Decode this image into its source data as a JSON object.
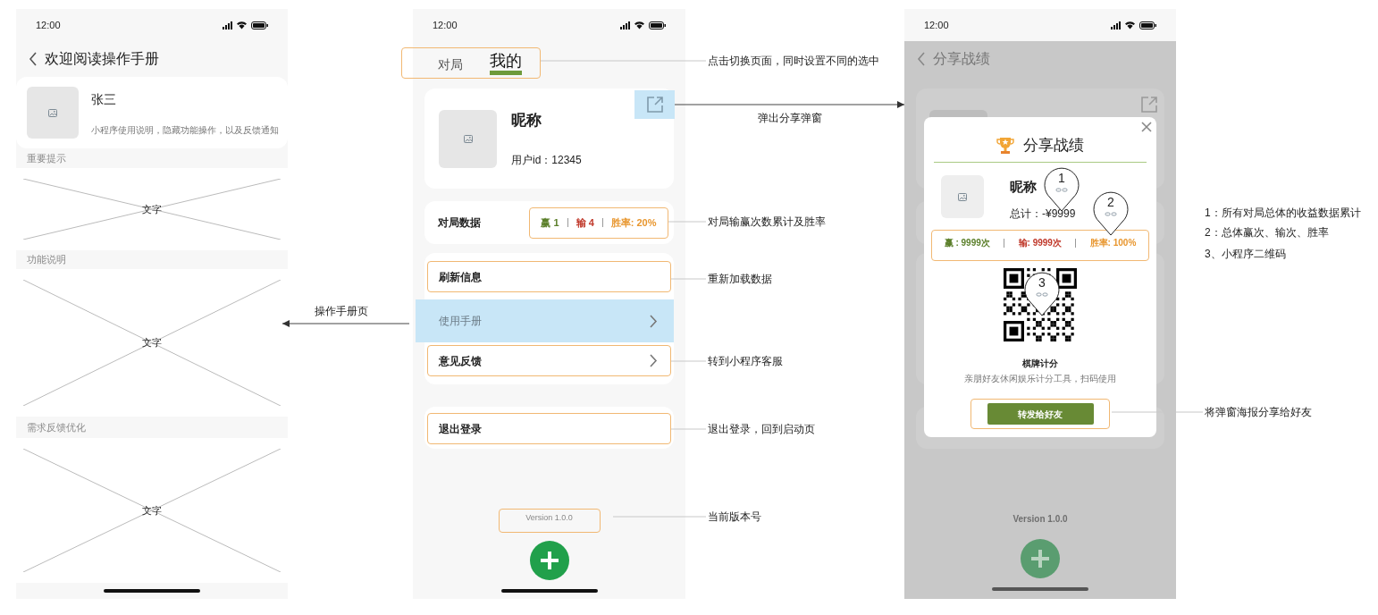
{
  "screens": [
    {
      "kind": "manual",
      "status_time": "12:00",
      "title": "欢迎阅读操作手册",
      "profile": {
        "name": "张三",
        "description": "小程序使用说明，隐藏功能操作，以及反馈通知"
      },
      "sections": [
        {
          "heading": "重要提示",
          "placeholder_text": "文字"
        },
        {
          "heading": "功能说明",
          "placeholder_text": "文字"
        },
        {
          "heading": "需求反馈优化",
          "placeholder_text": "文字"
        }
      ]
    },
    {
      "kind": "profile",
      "status_time": "12:00",
      "tabs": [
        {
          "label": "对局",
          "selected": false
        },
        {
          "label": "我的",
          "selected": true
        }
      ],
      "profile": {
        "nickname": "昵称",
        "user_id": "用户id：12345"
      },
      "stats": {
        "label": "对局数据",
        "wins": "赢 1",
        "losses": "输 4",
        "win_rate": "胜率: 20%"
      },
      "menu": [
        {
          "label": "刷新信息",
          "chevron": false,
          "highlighted": false
        },
        {
          "label": "使用手册",
          "chevron": true,
          "highlighted": true
        },
        {
          "label": "意见反馈",
          "chevron": true,
          "highlighted": false
        }
      ],
      "logout": "退出登录",
      "version": "Version 1.0.0"
    },
    {
      "kind": "share",
      "status_time": "12:00",
      "title": "分享战绩",
      "version": "Version 1.0.0",
      "modal": {
        "title": "分享战绩",
        "nickname": "昵称",
        "total": "总计：-¥9999",
        "wins": "赢 : 9999次",
        "losses": "输: 9999次",
        "win_rate": "胜率: 100%",
        "app_name": "棋牌计分",
        "app_tagline": "亲朋好友休闲娱乐计分工具，扫码使用",
        "share_button": "转发给好友",
        "pins": [
          "1",
          "2",
          "3"
        ]
      }
    }
  ],
  "annotations": [
    {
      "text": "点击切换页面，同时设置不同的选中",
      "arrow": false
    },
    {
      "text": "弹出分享弹窗",
      "arrow": true
    },
    {
      "text": "对局输赢次数累计及胜率",
      "arrow": false
    },
    {
      "text": "重新加载数据",
      "arrow": false
    },
    {
      "text": "操作手册页",
      "arrow": true
    },
    {
      "text": "转到小程序客服",
      "arrow": false
    },
    {
      "text": "退出登录，回到启动页",
      "arrow": false
    },
    {
      "text": "当前版本号",
      "arrow": false
    },
    {
      "text": "将弹窗海报分享给好友",
      "arrow": false
    }
  ],
  "notes": [
    "1：所有对局总体的收益数据累计",
    "2：总体赢次、输次、胜率",
    "3、小程序二维码"
  ]
}
